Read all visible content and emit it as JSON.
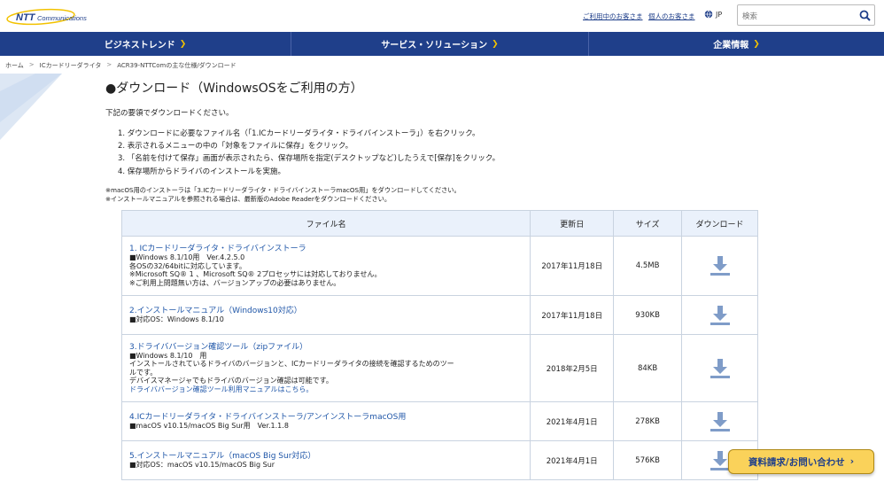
{
  "header": {
    "logo_text": "NTT Communications",
    "link_corporate": "ご利用中のお客さま",
    "link_personal": "個人のお客さま",
    "lang": "JP",
    "search_placeholder": "検索"
  },
  "nav": [
    {
      "label": "ビジネストレンド"
    },
    {
      "label": "サービス・ソリューション"
    },
    {
      "label": "企業情報"
    }
  ],
  "breadcrumb": [
    "ホーム",
    "ICカードリーダライタ",
    "ACR39-NTTComの主な仕様/ダウンロード"
  ],
  "page": {
    "title": "●ダウンロード（WindowsOSをご利用の方）",
    "intro": "下記の要領でダウンロードください。",
    "steps": [
      "1. ダウンロードに必要なファイル名（「1.ICカードリーダライタ・ドライバインストーラ」）を右クリック。",
      "2. 表示されるメニューの中の「対象をファイルに保存」をクリック。",
      "3. 「名前を付けて保存」画面が表示されたら、保存場所を指定(デスクトップなど)したうえで[保存]をクリック。",
      "4. 保存場所からドライバのインストールを実施。"
    ],
    "notes": [
      "※macOS用のインストーラは「3.ICカードリーダライタ・ドライバインストーラmacOS用」をダウンロードしてください。",
      "※インストールマニュアルを参照される場合は、最新版のAdobe Readerをダウンロードください。"
    ]
  },
  "table": {
    "headers": [
      "ファイル名",
      "更新日",
      "サイズ",
      "ダウンロード"
    ],
    "rows": [
      {
        "title": "1. ICカードリーダライタ・ドライバインストーラ",
        "desc": [
          "■Windows 8.1/10用　Ver.4.2.5.0",
          "各OSの32/64bitに対応しています。",
          "※Microsoft SQ® 1 、Microsoft SQ® 2プロセッサには対応しておりません。",
          "※ご利用上問題無い方は、バージョンアップの必要はありません。"
        ],
        "link": "",
        "date": "2017年11月18日",
        "size": "4.5MB"
      },
      {
        "title": "2.インストールマニュアル（Windows10対応）",
        "desc": [
          "■対応OS：Windows 8.1/10"
        ],
        "link": "",
        "date": "2017年11月18日",
        "size": "930KB"
      },
      {
        "title": "3.ドライババージョン確認ツール（zipファイル）",
        "desc": [
          "■Windows 8.1/10　用",
          "インストールされているドライバのバージョンと、ICカードリーダライタの接続を確認するためのツー",
          "ルです。",
          "デバイスマネージャでもドライバのバージョン確認は可能です。"
        ],
        "link": "ドライババージョン確認ツール利用マニュアルはこちら。",
        "date": "2018年2月5日",
        "size": "84KB"
      },
      {
        "title": "4.ICカードリーダライタ・ドライバインストーラ/アンインストーラmacOS用",
        "desc": [
          "■macOS v10.15/macOS Big Sur用　Ver.1.1.8"
        ],
        "link": "",
        "date": "2021年4月1日",
        "size": "278KB"
      },
      {
        "title": "5.インストールマニュアル（macOS Big Sur対応）",
        "desc": [
          "■対応OS：macOS v10.15/macOS Big Sur"
        ],
        "link": "",
        "date": "2021年4月1日",
        "size": "576KB"
      }
    ]
  },
  "cta": {
    "label": "資料請求/お問い合わせ",
    "arrow": "›"
  },
  "colors": {
    "navy": "#1f3f8a",
    "accent": "#f2c200",
    "link": "#1f56a8",
    "icon": "#7f9cc8"
  }
}
